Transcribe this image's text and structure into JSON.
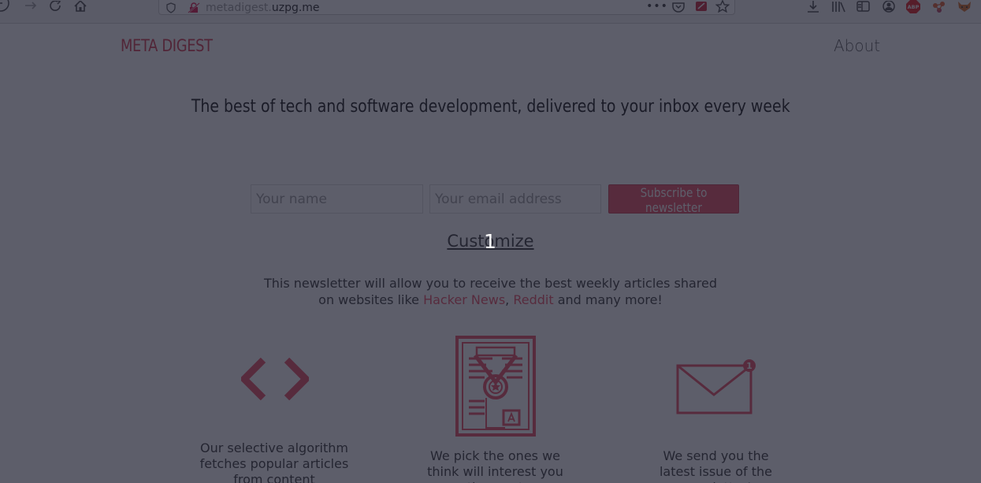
{
  "browser": {
    "url_domain_prefix": "metadigest.",
    "url_domain_main": "uzpg.me",
    "icons": [
      "back-icon",
      "forward-icon",
      "reload-icon",
      "home-icon",
      "shield-icon",
      "insecure-lock-icon",
      "more-icon",
      "pocket-icon",
      "screenshot-icon",
      "bookmark-star-icon",
      "download-icon",
      "library-icon",
      "sidebar-icon",
      "account-icon",
      "adblock-icon",
      "extension-icon",
      "fox-icon"
    ],
    "adblock_label": "ABP"
  },
  "page": {
    "logo": "META DIGEST",
    "nav_about": "About",
    "headline": "The best of tech and software development, delivered to your inbox every week",
    "form": {
      "name_placeholder": "Your name",
      "email_placeholder": "Your email address",
      "subscribe_label": "Subscribe to newsletter"
    },
    "customize_label": "Customize",
    "description_line1": "This newsletter will allow you to receive the best weekly articles shared",
    "description_prefix": "on websites like ",
    "link_hn": "Hacker News",
    "description_comma": ", ",
    "link_reddit": "Reddit",
    "description_suffix": " and many more!",
    "features": [
      {
        "icon": "code-brackets-icon",
        "text": "Our selective algorithm fetches popular articles from content aggregators"
      },
      {
        "icon": "certificate-icon",
        "text": "We pick the ones we think will interest you the most"
      },
      {
        "icon": "envelope-icon",
        "text": "We send you the latest issue of the newsletter!",
        "badge": "1"
      }
    ]
  },
  "overlay": {
    "marker": "1"
  },
  "colors": {
    "accent": "#e84a5f",
    "overlay": "#1e2030"
  }
}
